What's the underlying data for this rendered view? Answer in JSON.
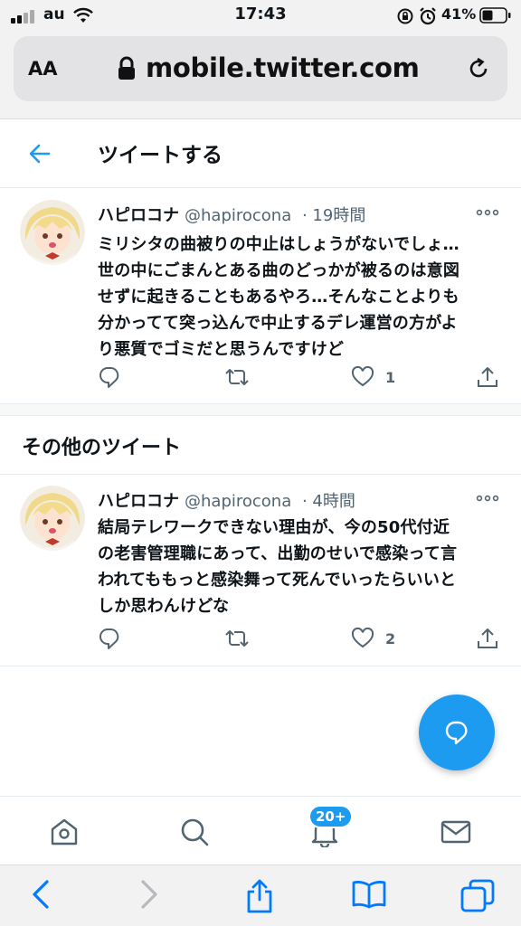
{
  "status_bar": {
    "carrier": "au",
    "time": "17:43",
    "battery_percent": "41%"
  },
  "browser": {
    "text_size_label": "AA",
    "url": "mobile.twitter.com"
  },
  "header": {
    "title": "ツイートする"
  },
  "tweets": [
    {
      "name": "ハピロコナ",
      "handle": "@hapirocona",
      "time": "· 19時間",
      "lines": [
        "ミリシタの曲被りの中止はしょうがないでしょ…",
        "世の中にごまんとある曲のどっかが被るのは意図",
        "せずに起きることもあるやろ…そんなことよりも",
        "分かってて突っ込んで中止するデレ運営の方がよ",
        "り悪質でゴミだと思うんですけど"
      ],
      "like_count": "1"
    },
    {
      "name": "ハピロコナ",
      "handle": "@hapirocona",
      "time": "· 4時間",
      "lines": [
        "結局テレワークできない理由が、今の50代付近",
        "の老害管理職にあって、出勤のせいで感染って言",
        "われてももっと感染舞って死んでいったらいいと",
        "しか思わんけどな"
      ],
      "like_count": "2"
    }
  ],
  "more_section": {
    "heading": "その他のツイート"
  },
  "bottom_nav": {
    "notification_badge": "20+"
  },
  "colors": {
    "accent": "#1d9bf0",
    "text_primary": "#0f1419",
    "text_secondary": "#536471",
    "safari_blue": "#007aff"
  },
  "icons": [
    "signal-icon",
    "wifi-icon",
    "lock-rotation-icon",
    "alarm-icon",
    "battery-icon",
    "lock-icon",
    "reload-icon",
    "back-arrow-icon",
    "more-icon",
    "reply-icon",
    "retweet-icon",
    "like-icon",
    "share-icon",
    "compose-icon",
    "home-icon",
    "search-icon",
    "bell-icon",
    "mail-icon",
    "safari-back-icon",
    "safari-forward-icon",
    "safari-share-icon",
    "bookmarks-icon",
    "tabs-icon"
  ]
}
